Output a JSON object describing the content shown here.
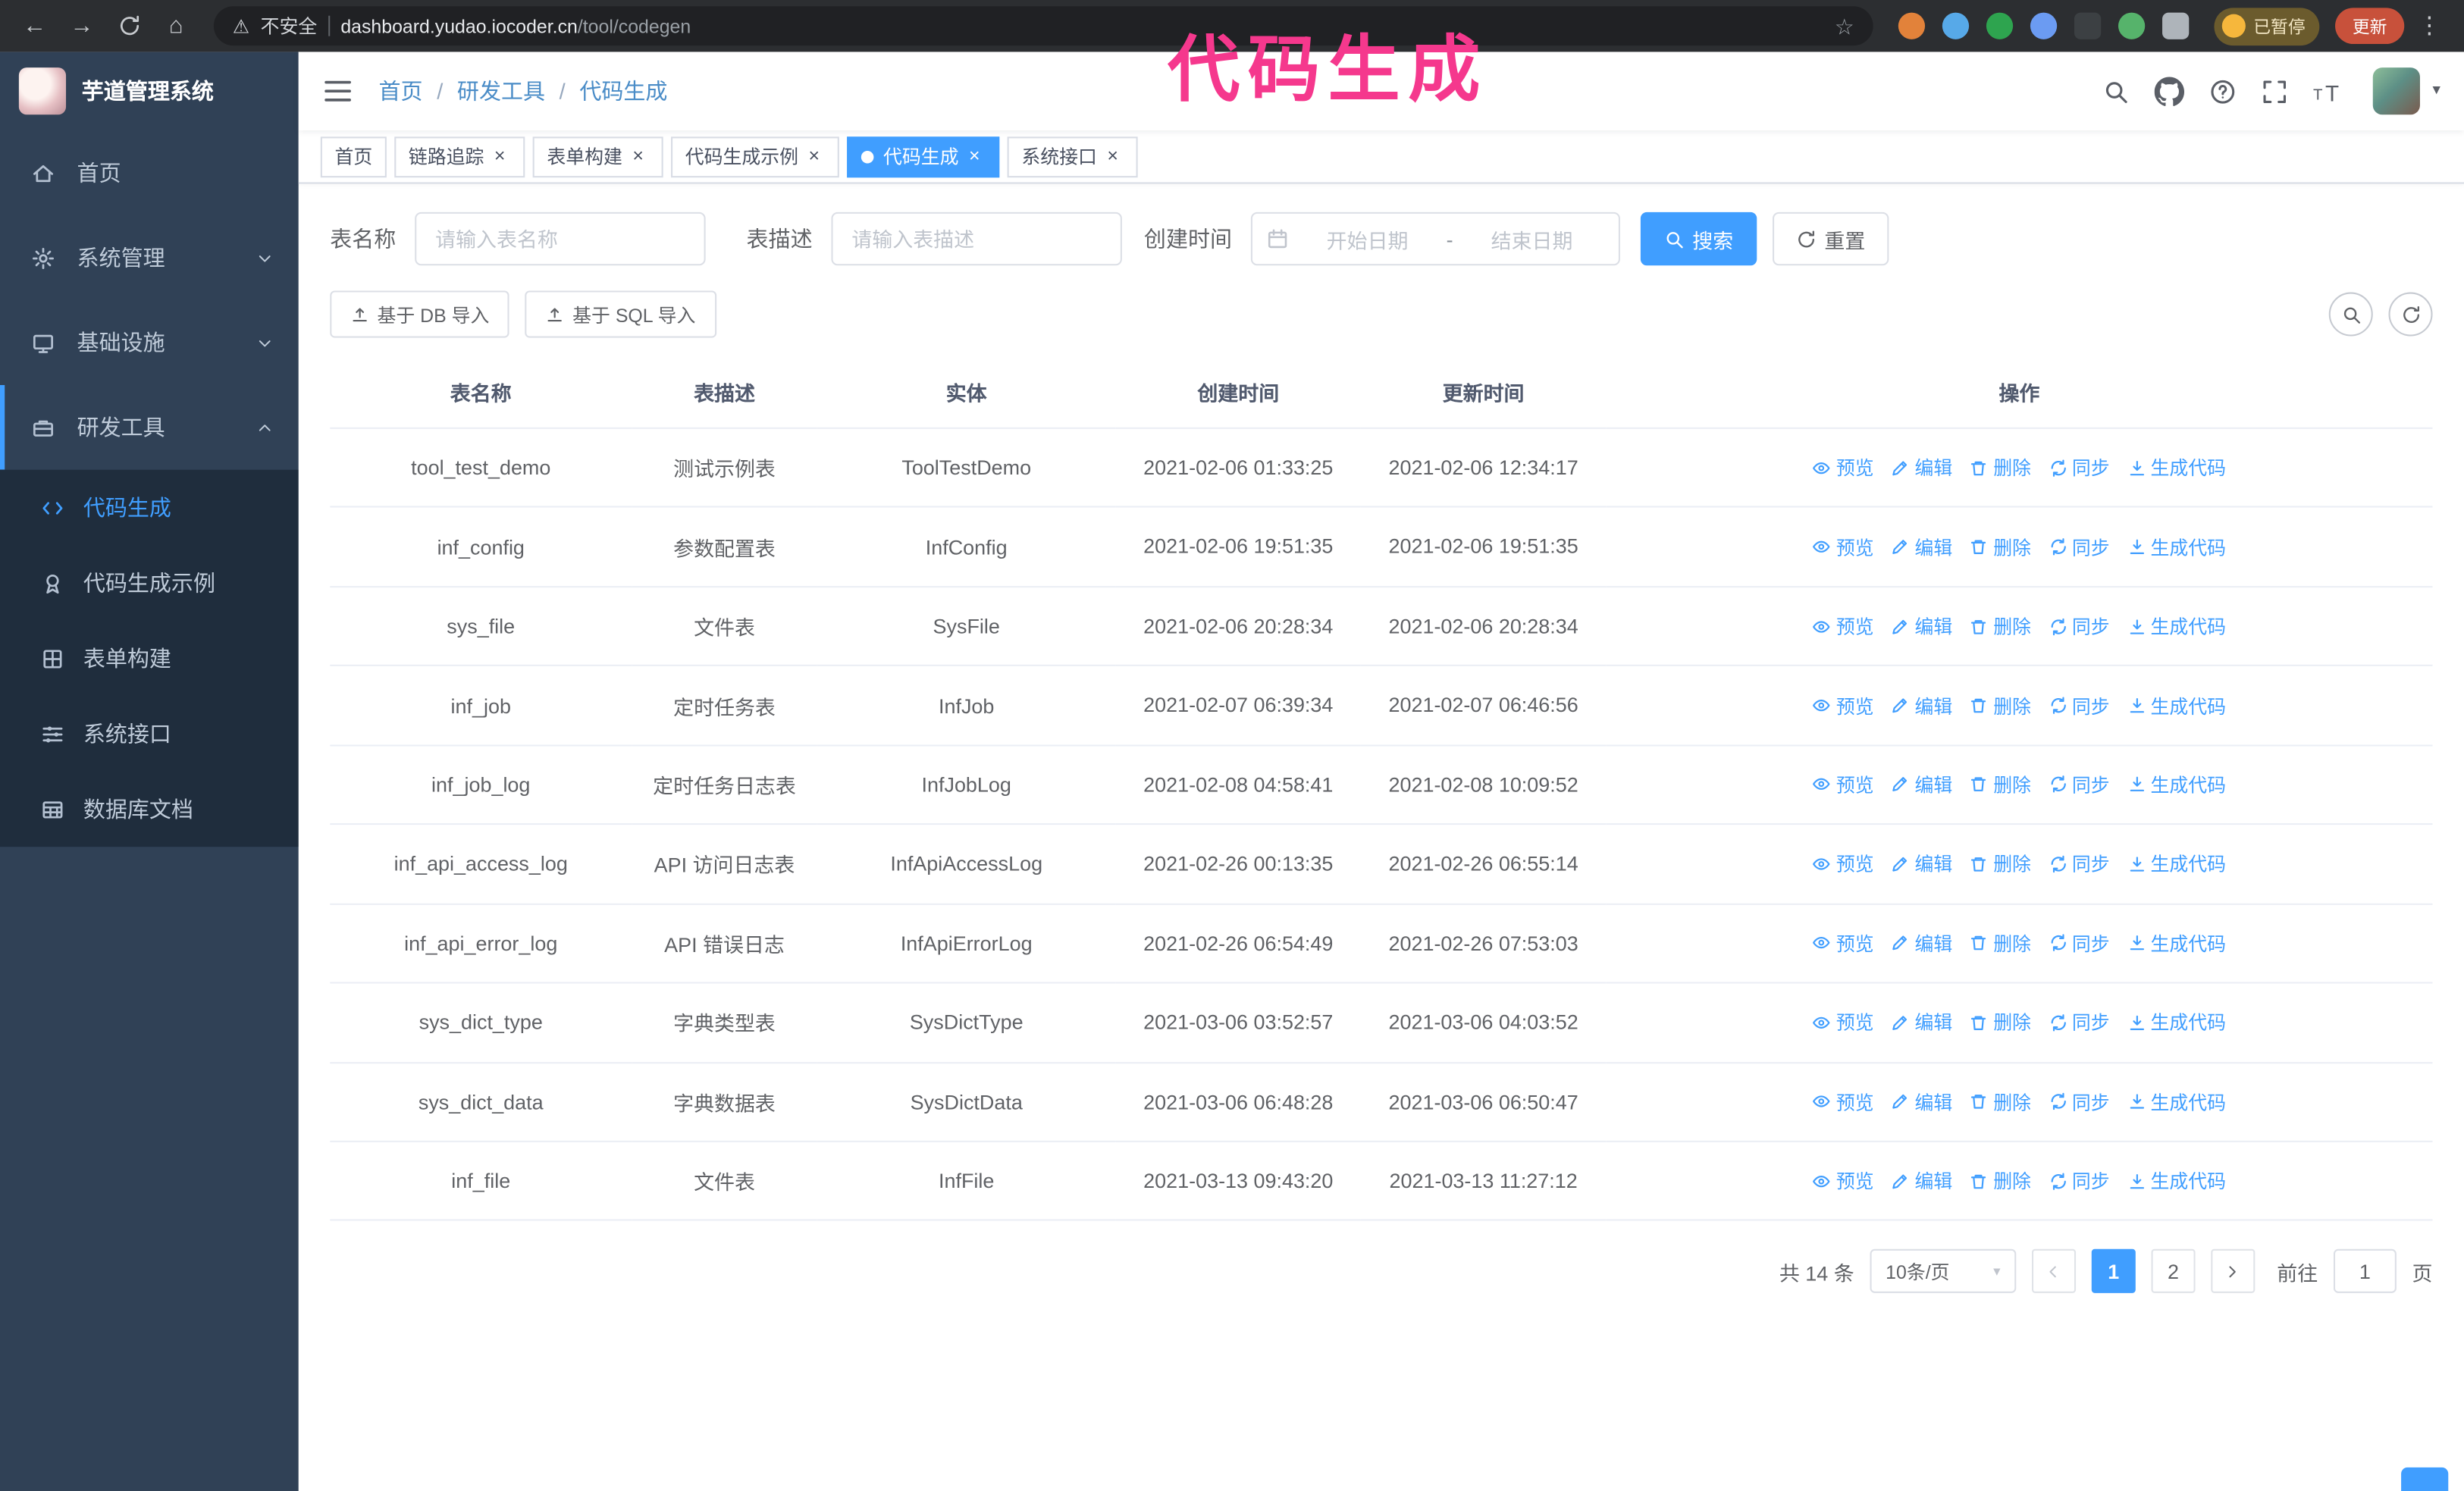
{
  "theme": {
    "accent": "#409eff",
    "sidebar_bg": "#304156",
    "submenu_bg": "#1f2d3d",
    "annotation_color": "#f5388d"
  },
  "annotation": {
    "text": "代码生成"
  },
  "browser": {
    "security_label": "不安全",
    "url_domain": "dashboard.yudao.iocoder.cn",
    "url_path": "/tool/codegen",
    "paused_badge": "已暂停",
    "update_button": "更新",
    "extensions": [
      {
        "color": "#e2823a",
        "shape": "circle"
      },
      {
        "color": "#57a9e8",
        "shape": "circle"
      },
      {
        "color": "#2ea44f",
        "shape": "circle"
      },
      {
        "color": "#6b9bf2",
        "shape": "circle"
      },
      {
        "color": "#3c4043",
        "shape": "square"
      },
      {
        "color": "#56b36b",
        "shape": "circle"
      },
      {
        "color": "#aeb4ba",
        "shape": "square"
      }
    ]
  },
  "sidebar": {
    "logo_title": "芋道管理系统",
    "items": [
      {
        "label": "首页",
        "icon": "home",
        "slug": "home",
        "type": "item",
        "expanded": false
      },
      {
        "label": "系统管理",
        "icon": "gear",
        "slug": "system",
        "type": "group",
        "expanded": false
      },
      {
        "label": "基础设施",
        "icon": "monitor",
        "slug": "infra",
        "type": "group",
        "expanded": false
      },
      {
        "label": "研发工具",
        "icon": "toolbox",
        "slug": "devtools",
        "type": "group",
        "expanded": true
      }
    ],
    "subitems": [
      {
        "label": "代码生成",
        "icon": "code",
        "slug": "codegen",
        "active": true
      },
      {
        "label": "代码生成示例",
        "icon": "medal",
        "slug": "codegen-example",
        "active": false
      },
      {
        "label": "表单构建",
        "icon": "grid",
        "slug": "form-builder",
        "active": false
      },
      {
        "label": "系统接口",
        "icon": "sliders",
        "slug": "api",
        "active": false
      },
      {
        "label": "数据库文档",
        "icon": "table",
        "slug": "db-doc",
        "active": false
      }
    ]
  },
  "header": {
    "breadcrumb": [
      "首页",
      "研发工具",
      "代码生成"
    ],
    "breadcrumb_separator": "/"
  },
  "tabs": [
    {
      "label": "首页",
      "closable": false,
      "active": false
    },
    {
      "label": "链路追踪",
      "closable": true,
      "active": false
    },
    {
      "label": "表单构建",
      "closable": true,
      "active": false
    },
    {
      "label": "代码生成示例",
      "closable": true,
      "active": false
    },
    {
      "label": "代码生成",
      "closable": true,
      "active": true
    },
    {
      "label": "系统接口",
      "closable": true,
      "active": false
    }
  ],
  "filters": {
    "table_name_label": "表名称",
    "table_name_placeholder": "请输入表名称",
    "table_desc_label": "表描述",
    "table_desc_placeholder": "请输入表描述",
    "create_time_label": "创建时间",
    "date_start_placeholder": "开始日期",
    "date_separator": "-",
    "date_end_placeholder": "结束日期",
    "search_button": "搜索",
    "reset_button": "重置"
  },
  "toolbar": {
    "import_db_button": "基于 DB 导入",
    "import_sql_button": "基于 SQL 导入"
  },
  "table": {
    "columns": [
      "表名称",
      "表描述",
      "实体",
      "创建时间",
      "更新时间",
      "操作"
    ],
    "actions": [
      {
        "label": "预览",
        "icon": "eye",
        "slug": "preview"
      },
      {
        "label": "编辑",
        "icon": "edit",
        "slug": "edit"
      },
      {
        "label": "删除",
        "icon": "trash",
        "slug": "delete"
      },
      {
        "label": "同步",
        "icon": "sync",
        "slug": "sync"
      },
      {
        "label": "生成代码",
        "icon": "download",
        "slug": "generate-code"
      }
    ],
    "rows": [
      {
        "name": "tool_test_demo",
        "desc": "测试示例表",
        "entity": "ToolTestDemo",
        "created": "2021-02-06 01:33:25",
        "updated": "2021-02-06 12:34:17"
      },
      {
        "name": "inf_config",
        "desc": "参数配置表",
        "entity": "InfConfig",
        "created": "2021-02-06 19:51:35",
        "updated": "2021-02-06 19:51:35"
      },
      {
        "name": "sys_file",
        "desc": "文件表",
        "entity": "SysFile",
        "created": "2021-02-06 20:28:34",
        "updated": "2021-02-06 20:28:34"
      },
      {
        "name": "inf_job",
        "desc": "定时任务表",
        "entity": "InfJob",
        "created": "2021-02-07 06:39:34",
        "updated": "2021-02-07 06:46:56"
      },
      {
        "name": "inf_job_log",
        "desc": "定时任务日志表",
        "entity": "InfJobLog",
        "created": "2021-02-08 04:58:41",
        "updated": "2021-02-08 10:09:52"
      },
      {
        "name": "inf_api_access_log",
        "desc": "API 访问日志表",
        "entity": "InfApiAccessLog",
        "created": "2021-02-26 00:13:35",
        "updated": "2021-02-26 06:55:14"
      },
      {
        "name": "inf_api_error_log",
        "desc": "API 错误日志",
        "entity": "InfApiErrorLog",
        "created": "2021-02-26 06:54:49",
        "updated": "2021-02-26 07:53:03"
      },
      {
        "name": "sys_dict_type",
        "desc": "字典类型表",
        "entity": "SysDictType",
        "created": "2021-03-06 03:52:57",
        "updated": "2021-03-06 04:03:52"
      },
      {
        "name": "sys_dict_data",
        "desc": "字典数据表",
        "entity": "SysDictData",
        "created": "2021-03-06 06:48:28",
        "updated": "2021-03-06 06:50:47"
      },
      {
        "name": "inf_file",
        "desc": "文件表",
        "entity": "InfFile",
        "created": "2021-03-13 09:43:20",
        "updated": "2021-03-13 11:27:12"
      }
    ]
  },
  "pagination": {
    "total_text": "共 14 条",
    "page_size": "10条/页",
    "pages": [
      {
        "label": "1",
        "active": true
      },
      {
        "label": "2",
        "active": false
      }
    ],
    "goto_label": "前往",
    "goto_value": "1",
    "goto_suffix": "页"
  }
}
